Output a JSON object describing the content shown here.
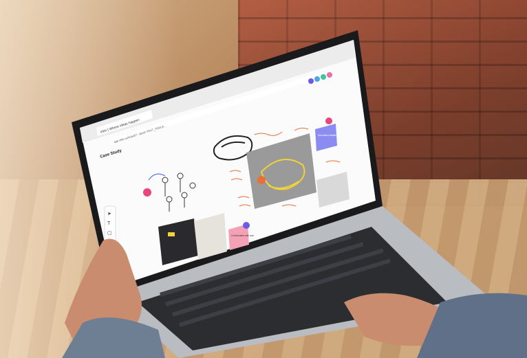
{
  "browser": {
    "tab_title": "Vibe | Where ideas happen",
    "url": "app.vibe.us/board/?...&tool=TEXT_TOOL&..."
  },
  "board": {
    "title": "Case Study",
    "sticky_yellow": "Sensation details",
    "sticky_pink": "Comfortable with use"
  },
  "colors": {
    "brand_purple": "#6b5be8",
    "sticky_blue": "#8a8cf2",
    "sticky_pink": "#f4a1b5",
    "sketch_orange": "#e8703a",
    "sketch_yellow": "#f1d23a"
  }
}
